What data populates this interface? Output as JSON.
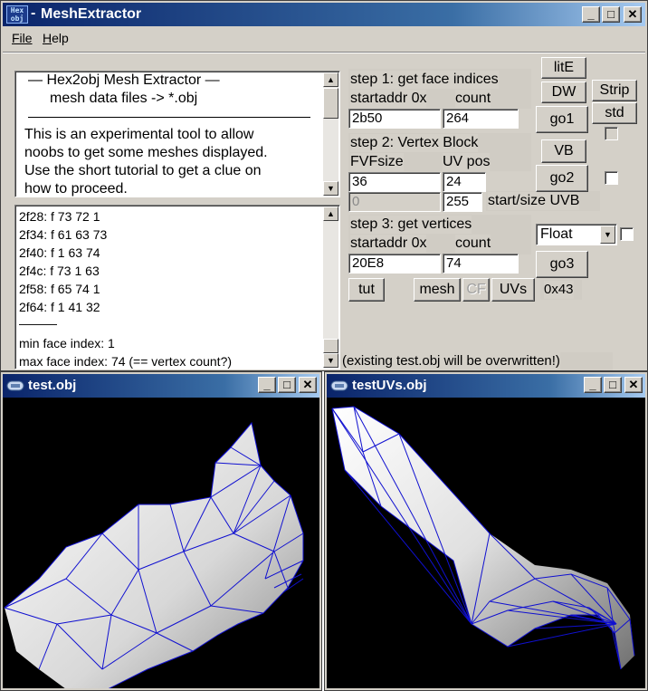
{
  "main_window": {
    "title": "MeshExtractor",
    "icon_text": "Hex obj",
    "controls": {
      "minimize": "_",
      "maximize": "□",
      "close": "✕"
    }
  },
  "menu": {
    "file": "File",
    "help": "Help"
  },
  "info": {
    "lines": [
      "—   Hex2obj Mesh Extractor   —",
      "mesh data files -> *.obj",
      "This is an experimental tool to allow",
      "noobs to get some meshes displayed.",
      "Use the short tutorial to get a clue on",
      "how to proceed."
    ]
  },
  "log": {
    "lines": [
      "2f28: f  73 72 1",
      "2f34: f  61 63 73",
      "2f40: f  1 63 74",
      "2f4c: f  73 1 63",
      "2f58: f  65 74 1",
      "2f64: f  1 41 32",
      "———",
      "min face index: 1",
      "max face index: 74 (== vertex count?)"
    ]
  },
  "step1": {
    "title": "step 1: get face indices",
    "startaddr_label": "startaddr 0x",
    "count_label": "count",
    "startaddr": "2b50",
    "count": "264",
    "go_label": "go1"
  },
  "step2": {
    "title": "step 2: Vertex Block",
    "fvfsize_label": "FVFsize",
    "uvpos_label": "UV pos",
    "fvfsize": "36",
    "uvpos": "24",
    "uvb_start": "0",
    "uvb_size": "255",
    "uvb_label": "start/size UVB",
    "go_label": "go2"
  },
  "step3": {
    "title": "step 3: get vertices",
    "startaddr_label": "startaddr 0x",
    "count_label": "count",
    "startaddr": "20E8",
    "count": "74",
    "go_label": "go3",
    "format_selected": "Float"
  },
  "buttons": {
    "lite": "litE",
    "dw": "DW",
    "strip": "Strip",
    "std": "std",
    "vb": "VB",
    "tut": "tut",
    "mesh": "mesh",
    "cf": "CF",
    "uvs": "UVs"
  },
  "hex_readout": "0x43",
  "status": "(existing test.obj will be overwritten!)",
  "viewer1": {
    "title": "test.obj"
  },
  "viewer2": {
    "title": "testUVs.obj"
  },
  "colors": {
    "wireframe": "#1010d0",
    "title_active": "#0a246a",
    "viewport_bg": "#000000"
  }
}
